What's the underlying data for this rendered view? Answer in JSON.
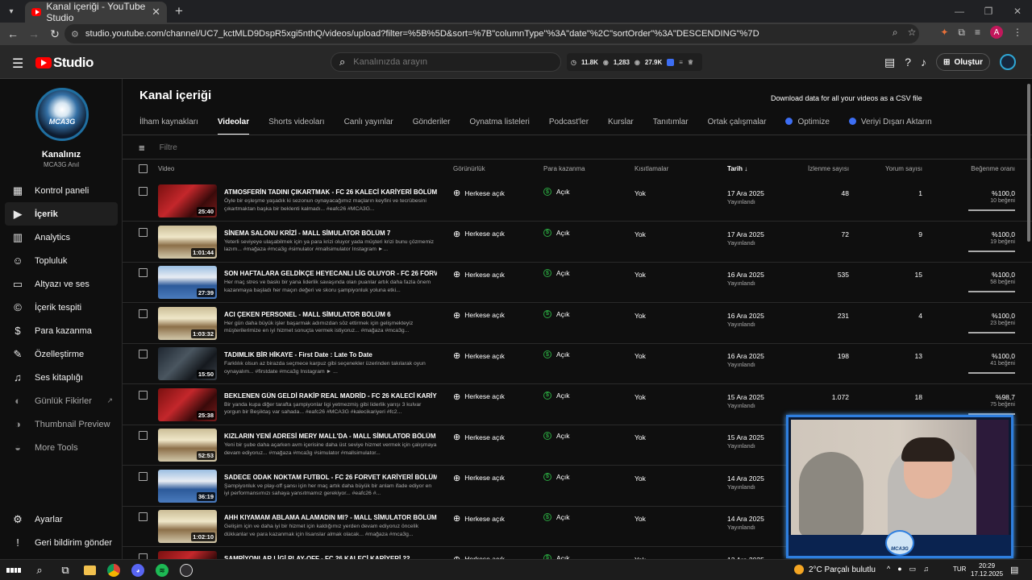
{
  "browser": {
    "tab_title": "Kanal içeriği - YouTube Studio",
    "url": "studio.youtube.com/channel/UC7_kctMLD9DspR5xgi5nthQ/videos/upload?filter=%5B%5D&sort=%7B\"columnType\"%3A\"date\"%2C\"sortOrder\"%3A\"DESCENDING\"%7D",
    "profile_initial": "A"
  },
  "header": {
    "logo_text": "Studio",
    "search_placeholder": "Kanalınızda arayın",
    "stats": {
      "views": "11.8K",
      "likes": "1,283",
      "subs": "27.9K"
    },
    "create_label": "Oluştur"
  },
  "sidebar": {
    "avatar_text": "MCA3G",
    "channel_label": "Kanalınız",
    "channel_name": "MCA3G Anıl",
    "items": [
      {
        "label": "Kontrol paneli",
        "icon": "dashboard-icon"
      },
      {
        "label": "İçerik",
        "icon": "content-icon",
        "active": true
      },
      {
        "label": "Analytics",
        "icon": "analytics-icon"
      },
      {
        "label": "Topluluk",
        "icon": "community-icon"
      },
      {
        "label": "Altyazı ve ses",
        "icon": "subtitles-icon"
      },
      {
        "label": "İçerik tespiti",
        "icon": "copyright-icon"
      },
      {
        "label": "Para kazanma",
        "icon": "dollar-icon"
      },
      {
        "label": "Özelleştirme",
        "icon": "customize-icon"
      },
      {
        "label": "Ses kitaplığı",
        "icon": "audio-library-icon"
      },
      {
        "label": "Günlük Fikirler",
        "icon": "ideas-icon"
      },
      {
        "label": "Thumbnail Preview",
        "icon": "thumbnail-icon"
      },
      {
        "label": "More Tools",
        "icon": "tools-icon"
      }
    ],
    "bottom": [
      {
        "label": "Ayarlar",
        "icon": "settings-icon"
      },
      {
        "label": "Geri bildirim gönder",
        "icon": "feedback-icon"
      }
    ]
  },
  "main": {
    "title": "Kanal içeriği",
    "tooltip": "Download data for all your videos as a CSV file",
    "tabs": [
      "İlham kaynakları",
      "Videolar",
      "Shorts videoları",
      "Canlı yayınlar",
      "Gönderiler",
      "Oynatma listeleri",
      "Podcast'ler",
      "Kurslar",
      "Tanıtımlar",
      "Ortak çalışmalar",
      "Optimize",
      "Veriyi Dışarı Aktarın"
    ],
    "filter_placeholder": "Filtre",
    "columns": {
      "video": "Video",
      "visibility": "Görünürlük",
      "monetization": "Para kazanma",
      "restrictions": "Kısıtlamalar",
      "date": "Tarih",
      "views": "İzlenme sayısı",
      "comments": "Yorum sayısı",
      "likes": "Beğenme oranı"
    },
    "rows": [
      {
        "title": "ATMOSFERİN TADINI ÇIKARTMAK - FC 26 KALECİ KARİYERİ BÖLÜM 24",
        "desc": "Öyle bir eşleşme yaşadık ki sezonun oynayacağımız maçların keyfini ve tecrübesini çıkartmaktan başka bir beklenti kalmadı... #eafc26 #MCA3G...",
        "duration": "25:40",
        "visibility": "Herkese açık",
        "monetization": "Açık",
        "restrictions": "Yok",
        "date": "17 Ara 2025",
        "published": "Yayınlandı",
        "views": "48",
        "comments": "1",
        "like_pct": "%100,0",
        "likes": "10 beğeni",
        "theme": "red"
      },
      {
        "title": "SİNEMA SALONU KRİZİ - MALL SİMULATOR BÖLÜM 7",
        "desc": "Yeterli seviyeye ulaşabilmek için ya para krizi oluyor yada müşteri krizi bunu çözmemiz lazım... #mağaza #mca3g #simulator #mallsimulator Instagram ►...",
        "duration": "1:01:44",
        "visibility": "Herkese açık",
        "monetization": "Açık",
        "restrictions": "Yok",
        "date": "17 Ara 2025",
        "published": "Yayınlandı",
        "views": "72",
        "comments": "9",
        "like_pct": "%100,0",
        "likes": "19 beğeni",
        "theme": "mall"
      },
      {
        "title": "SON HAFTALARA GELDİKÇE HEYECANLI LİG OLUYOR - FC 26 FORVET K...",
        "desc": "Her maç stres ve baskı bir yana liderlik savaşında olan puanlar artık daha fazla önem kazanmaya başladı her maçın değeri ve skoru şampiyonluk yoluna etki...",
        "duration": "27:39",
        "visibility": "Herkese açık",
        "monetization": "Açık",
        "restrictions": "Yok",
        "date": "16 Ara 2025",
        "published": "Yayınlandı",
        "views": "535",
        "comments": "15",
        "like_pct": "%100,0",
        "likes": "58 beğeni",
        "theme": "stadium"
      },
      {
        "title": "ACI ÇEKEN PERSONEL - MALL SİMULATOR BÖLÜM 6",
        "desc": "Her gün daha büyük işler başarmak adımızdan söz ettirmek için gelişmekteyiz müşterilerimize en iyi hizmet sonuçta vermek istiyoruz... #mağaza #mca3g...",
        "duration": "1:03:32",
        "visibility": "Herkese açık",
        "monetization": "Açık",
        "restrictions": "Yok",
        "date": "16 Ara 2025",
        "published": "Yayınlandı",
        "views": "231",
        "comments": "4",
        "like_pct": "%100,0",
        "likes": "23 beğeni",
        "theme": "mall"
      },
      {
        "title": "TADIMLIK BİR HİKAYE - First Date : Late To Date",
        "desc": "Farklılık olsun az birazda seçmece karpuz gibi seçenekler üzerinden takılarak oyun oynayalım... #firstdate #mca3g Instagram ► ...",
        "duration": "15:50",
        "visibility": "Herkese açık",
        "monetization": "Açık",
        "restrictions": "Yok",
        "date": "16 Ara 2025",
        "published": "Yayınlandı",
        "views": "198",
        "comments": "13",
        "like_pct": "%100,0",
        "likes": "41 beğeni",
        "theme": "dark"
      },
      {
        "title": "BEKLENEN GÜN GELDİ RAKİP REAL MADRİD - FC 26 KALECİ KARİYERİ B...",
        "desc": "Bir yanda kupa diğer tarafta şampiyonlar ligi yetmezmiş gibi liderlik yarışı 3 kulvar yorgun bir Beşiktaş var sahada... #eafc26 #MCA3G #kalecikariyeri #fc2...",
        "duration": "25:38",
        "visibility": "Herkese açık",
        "monetization": "Açık",
        "restrictions": "Yok",
        "date": "15 Ara 2025",
        "published": "Yayınlandı",
        "views": "1.072",
        "comments": "18",
        "like_pct": "%98,7",
        "likes": "75 beğeni",
        "theme": "red"
      },
      {
        "title": "KIZLARIN YENİ ADRESİ MERY MALL'DA - MALL SİMULATOR BÖLÜM 5",
        "desc": "Yeni bir şube daha açarken avm içerisine daha üst seviye hizmet vermek için çalışmaya devam ediyoruz... #mağaza #mca3g #simulator #mallsimulator...",
        "duration": "52:53",
        "visibility": "Herkese açık",
        "monetization": "Açık",
        "restrictions": "Yok",
        "date": "15 Ara 2025",
        "published": "Yayınlandı",
        "views": "",
        "comments": "",
        "like_pct": "",
        "likes": "",
        "theme": "mall"
      },
      {
        "title": "SADECE ODAK NOKTAM FUTBOL - FC 26 FORVET KARİYERİ BÖLÜM 9",
        "desc": "Şampiyonluk ve play-off şansı için her maç artık daha büyük bir anlam ifade ediyor en iyi performansımızı sahaya yansıtmamız gerekiyor... #eafc26 #...",
        "duration": "36:19",
        "visibility": "Herkese açık",
        "monetization": "Açık",
        "restrictions": "Yok",
        "date": "14 Ara 2025",
        "published": "Yayınlandı",
        "views": "",
        "comments": "",
        "like_pct": "",
        "likes": "",
        "theme": "stadium"
      },
      {
        "title": "AHH KIYAMAM ABLAMA ALAMADIN MI? - MALL SİMULATOR BÖLÜM 4",
        "desc": "Gelişim için ve daha iyi bir hizmet için kaldığımız yerden devam ediyoruz öncelik dükkanlar ve para kazanmak için lisanslar almak olacak... #mağaza #mca3g...",
        "duration": "1:02:10",
        "visibility": "Herkese açık",
        "monetization": "Açık",
        "restrictions": "Yok",
        "date": "14 Ara 2025",
        "published": "Yayınlandı",
        "views": "",
        "comments": "",
        "like_pct": "",
        "likes": "",
        "theme": "mall"
      },
      {
        "title": "ŞAMPİYONLAR LİGİ PLAY-OFF - FC 26 KALECİ KARİYERİ 22",
        "desc": "",
        "duration": "",
        "visibility": "Herkese açık",
        "monetization": "Açık",
        "restrictions": "Yok",
        "date": "13 Ara 2025",
        "published": "",
        "views": "",
        "comments": "",
        "like_pct": "",
        "likes": "",
        "theme": "red"
      }
    ]
  },
  "webcam": {
    "badge_text": "MCA3G"
  },
  "taskbar": {
    "weather": "2°C  Parçalı bulutlu",
    "lang": "TUR",
    "time": "20:29",
    "date": "17.12.2025"
  },
  "colors": {
    "accent_blue": "#3d6ef3",
    "monetization_green": "#2ba640",
    "youtube_red": "#ff0000"
  }
}
